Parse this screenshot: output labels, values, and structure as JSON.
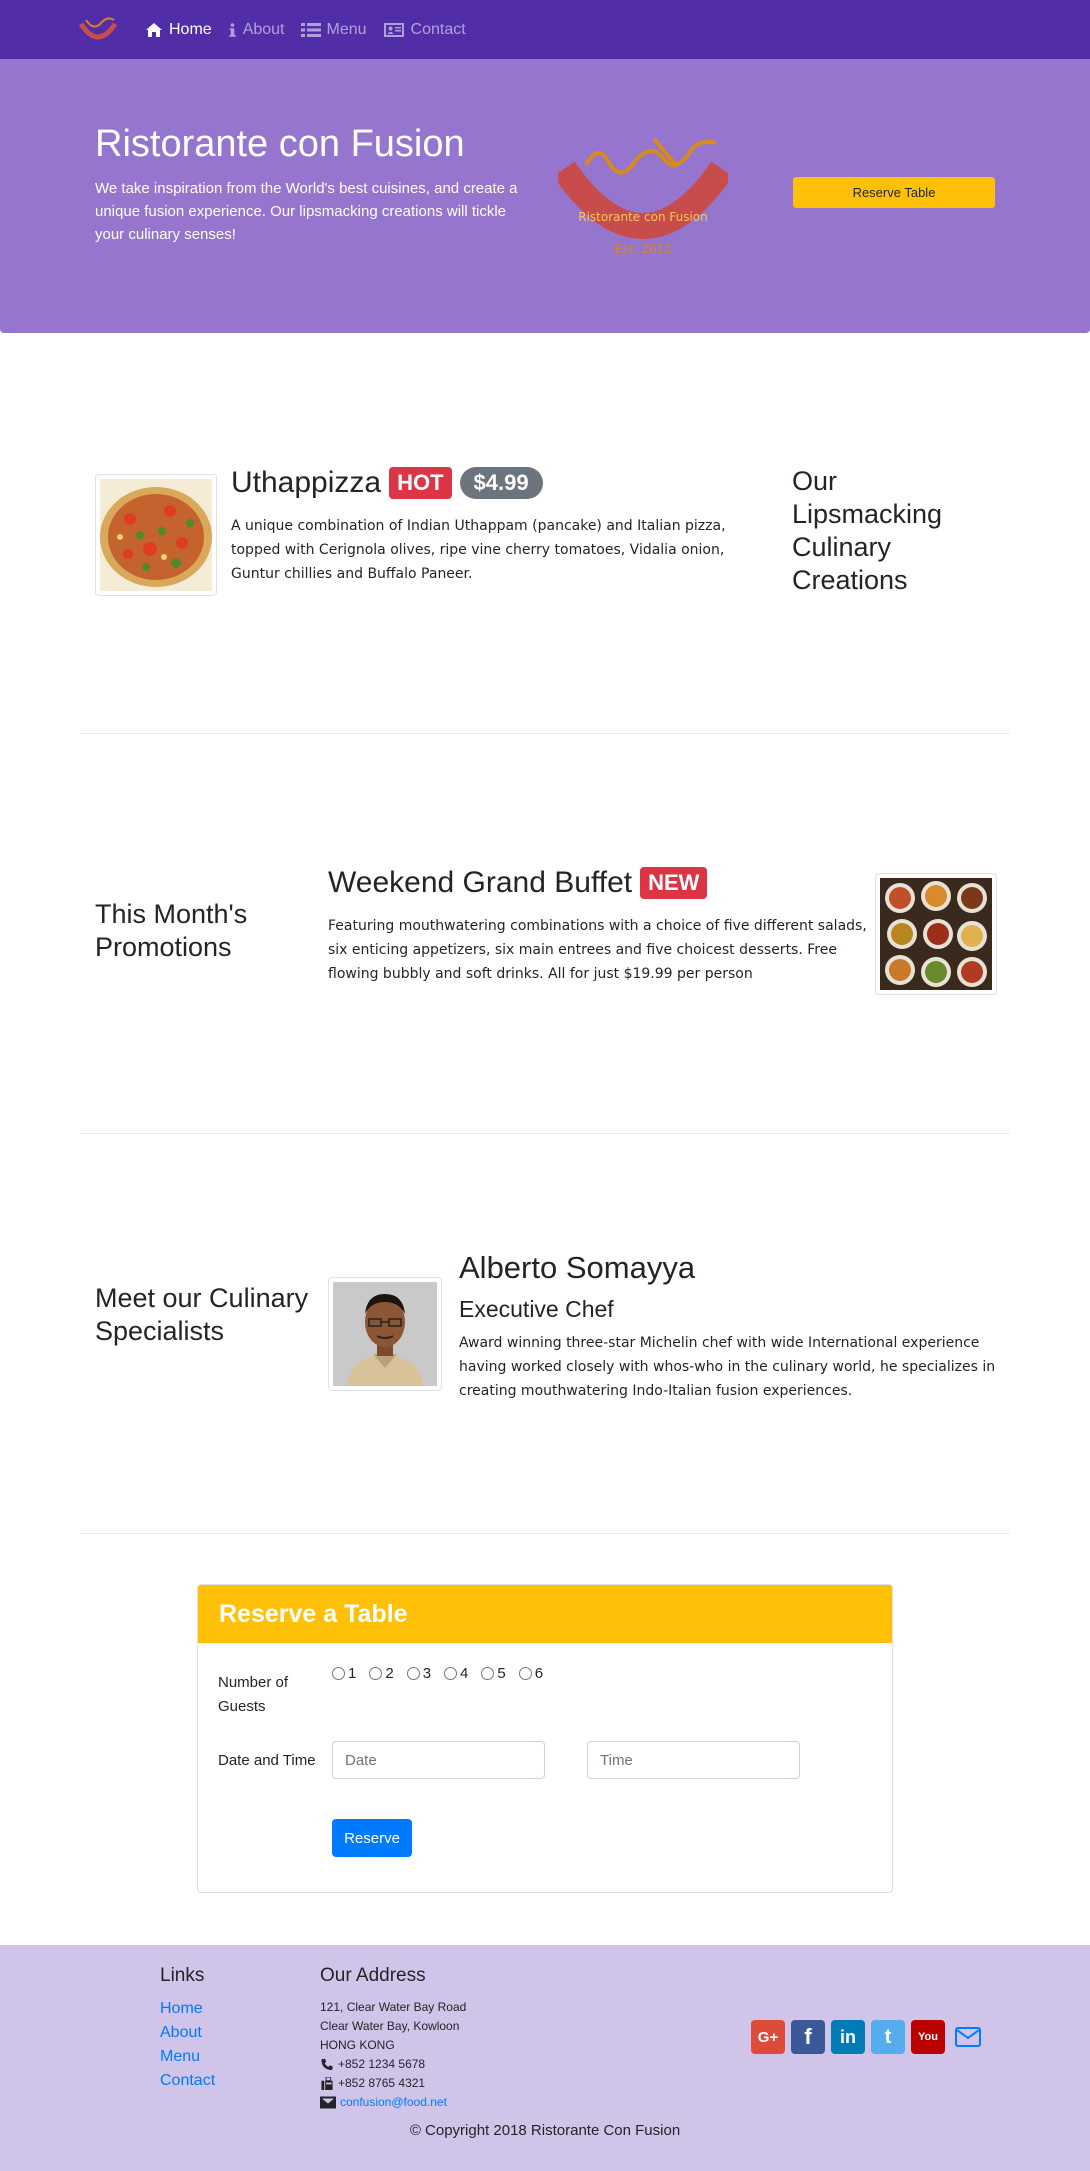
{
  "navbar": {
    "items": [
      {
        "label": "Home",
        "icon": "home-icon",
        "active": true
      },
      {
        "label": "About",
        "icon": "info-icon"
      },
      {
        "label": "Menu",
        "icon": "list-icon"
      },
      {
        "label": "Contact",
        "icon": "address-card-icon"
      }
    ]
  },
  "jumbotron": {
    "title": "Ristorante con Fusion",
    "text": "We take inspiration from the World's best cuisines, and create a unique fusion experience. Our lipsmacking creations will tickle your culinary senses!",
    "logo_text": "Ristorante con Fusion",
    "logo_est": "Est. 2013",
    "reserve_label": "Reserve Table"
  },
  "dish": {
    "name": "Uthappizza",
    "badge": "HOT",
    "price": "$4.99",
    "description": "A unique combination of Indian Uthappam (pancake) and Italian pizza, topped with Cerignola olives, ripe vine cherry tomatoes, Vidalia onion, Guntur chillies and Buffalo Paneer.",
    "heading": "Our Lipsmacking Culinary Creations"
  },
  "promotion": {
    "heading": "This Month's Promotions",
    "name": "Weekend Grand Buffet",
    "badge": "NEW",
    "description": "Featuring mouthwatering combinations with a choice of five different salads, six enticing appetizers, six main entrees and five choicest desserts. Free flowing bubbly and soft drinks. All for just $19.99 per person"
  },
  "leader": {
    "heading": "Meet our Culinary Specialists",
    "name": "Alberto Somayya",
    "designation": "Executive Chef",
    "description": "Award winning three-star Michelin chef with wide International experience having worked closely with whos-who in the culinary world, he specializes in creating mouthwatering Indo-Italian fusion experiences."
  },
  "reservation": {
    "title": "Reserve a Table",
    "guests_label": "Number of Guests",
    "guest_options": [
      "1",
      "2",
      "3",
      "4",
      "5",
      "6"
    ],
    "datetime_label": "Date and Time",
    "date_placeholder": "Date",
    "time_placeholder": "Time",
    "submit_label": "Reserve"
  },
  "footer": {
    "links_heading": "Links",
    "links": [
      "Home",
      "About",
      "Menu",
      "Contact"
    ],
    "address_heading": "Our Address",
    "address_lines": [
      "121, Clear Water Bay Road",
      "Clear Water Bay, Kowloon",
      "HONG KONG"
    ],
    "phone": "+852 1234 5678",
    "fax": "+852 8765 4321",
    "email": "confusion@food.net",
    "socials": [
      {
        "name": "google-plus-icon",
        "glyph": "G+",
        "color": "#dd4b39"
      },
      {
        "name": "facebook-icon",
        "glyph": "f",
        "color": "#3b5998"
      },
      {
        "name": "linkedin-icon",
        "glyph": "in",
        "color": "#007bb6"
      },
      {
        "name": "twitter-icon",
        "glyph": "t",
        "color": "#55acee"
      },
      {
        "name": "youtube-icon",
        "glyph": "You",
        "color": "#bb0000"
      }
    ],
    "copyright": "© Copyright 2018 Ristorante Con Fusion"
  },
  "colors": {
    "navbar": "#512DA8",
    "jumbotron": "#9575CD",
    "footer": "#D1C4E9",
    "accent": "#FFC107",
    "primary": "#007bff"
  }
}
